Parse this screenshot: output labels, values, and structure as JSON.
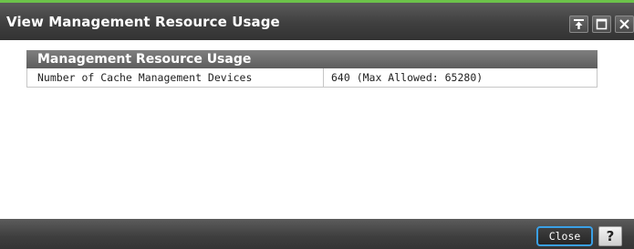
{
  "window": {
    "title": "View Management Resource Usage",
    "controls": [
      {
        "name": "pin-icon"
      },
      {
        "name": "maximize-icon"
      },
      {
        "name": "close-icon"
      }
    ],
    "accent_color": "#6cc24a"
  },
  "panel": {
    "header": "Management Resource Usage",
    "rows": [
      {
        "label": "Number of Cache Management Devices",
        "value": "640 (Max Allowed: 65280)"
      }
    ]
  },
  "footer": {
    "close_label": "Close",
    "help_label": "?",
    "close_border_color": "#3aa0e6"
  }
}
